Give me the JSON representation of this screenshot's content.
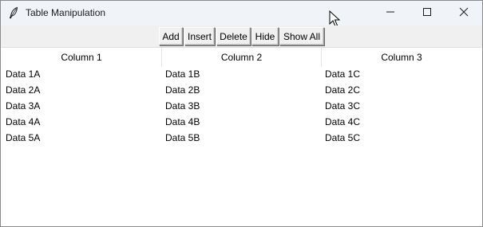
{
  "window": {
    "title": "Table Manipulation",
    "icon": "feather-icon",
    "controls": [
      "minimize-icon",
      "maximize-icon",
      "close-icon"
    ]
  },
  "toolbar": {
    "add_label": "Add",
    "insert_label": "Insert",
    "delete_label": "Delete",
    "hide_label": "Hide",
    "show_all_label": "Show All"
  },
  "table": {
    "columns": [
      "Column 1",
      "Column 2",
      "Column 3"
    ],
    "rows": [
      [
        "Data 1A",
        "Data 1B",
        "Data 1C"
      ],
      [
        "Data 2A",
        "Data 2B",
        "Data 2C"
      ],
      [
        "Data 3A",
        "Data 3B",
        "Data 3C"
      ],
      [
        "Data 4A",
        "Data 4B",
        "Data 4C"
      ],
      [
        "Data 5A",
        "Data 5B",
        "Data 5C"
      ]
    ]
  }
}
